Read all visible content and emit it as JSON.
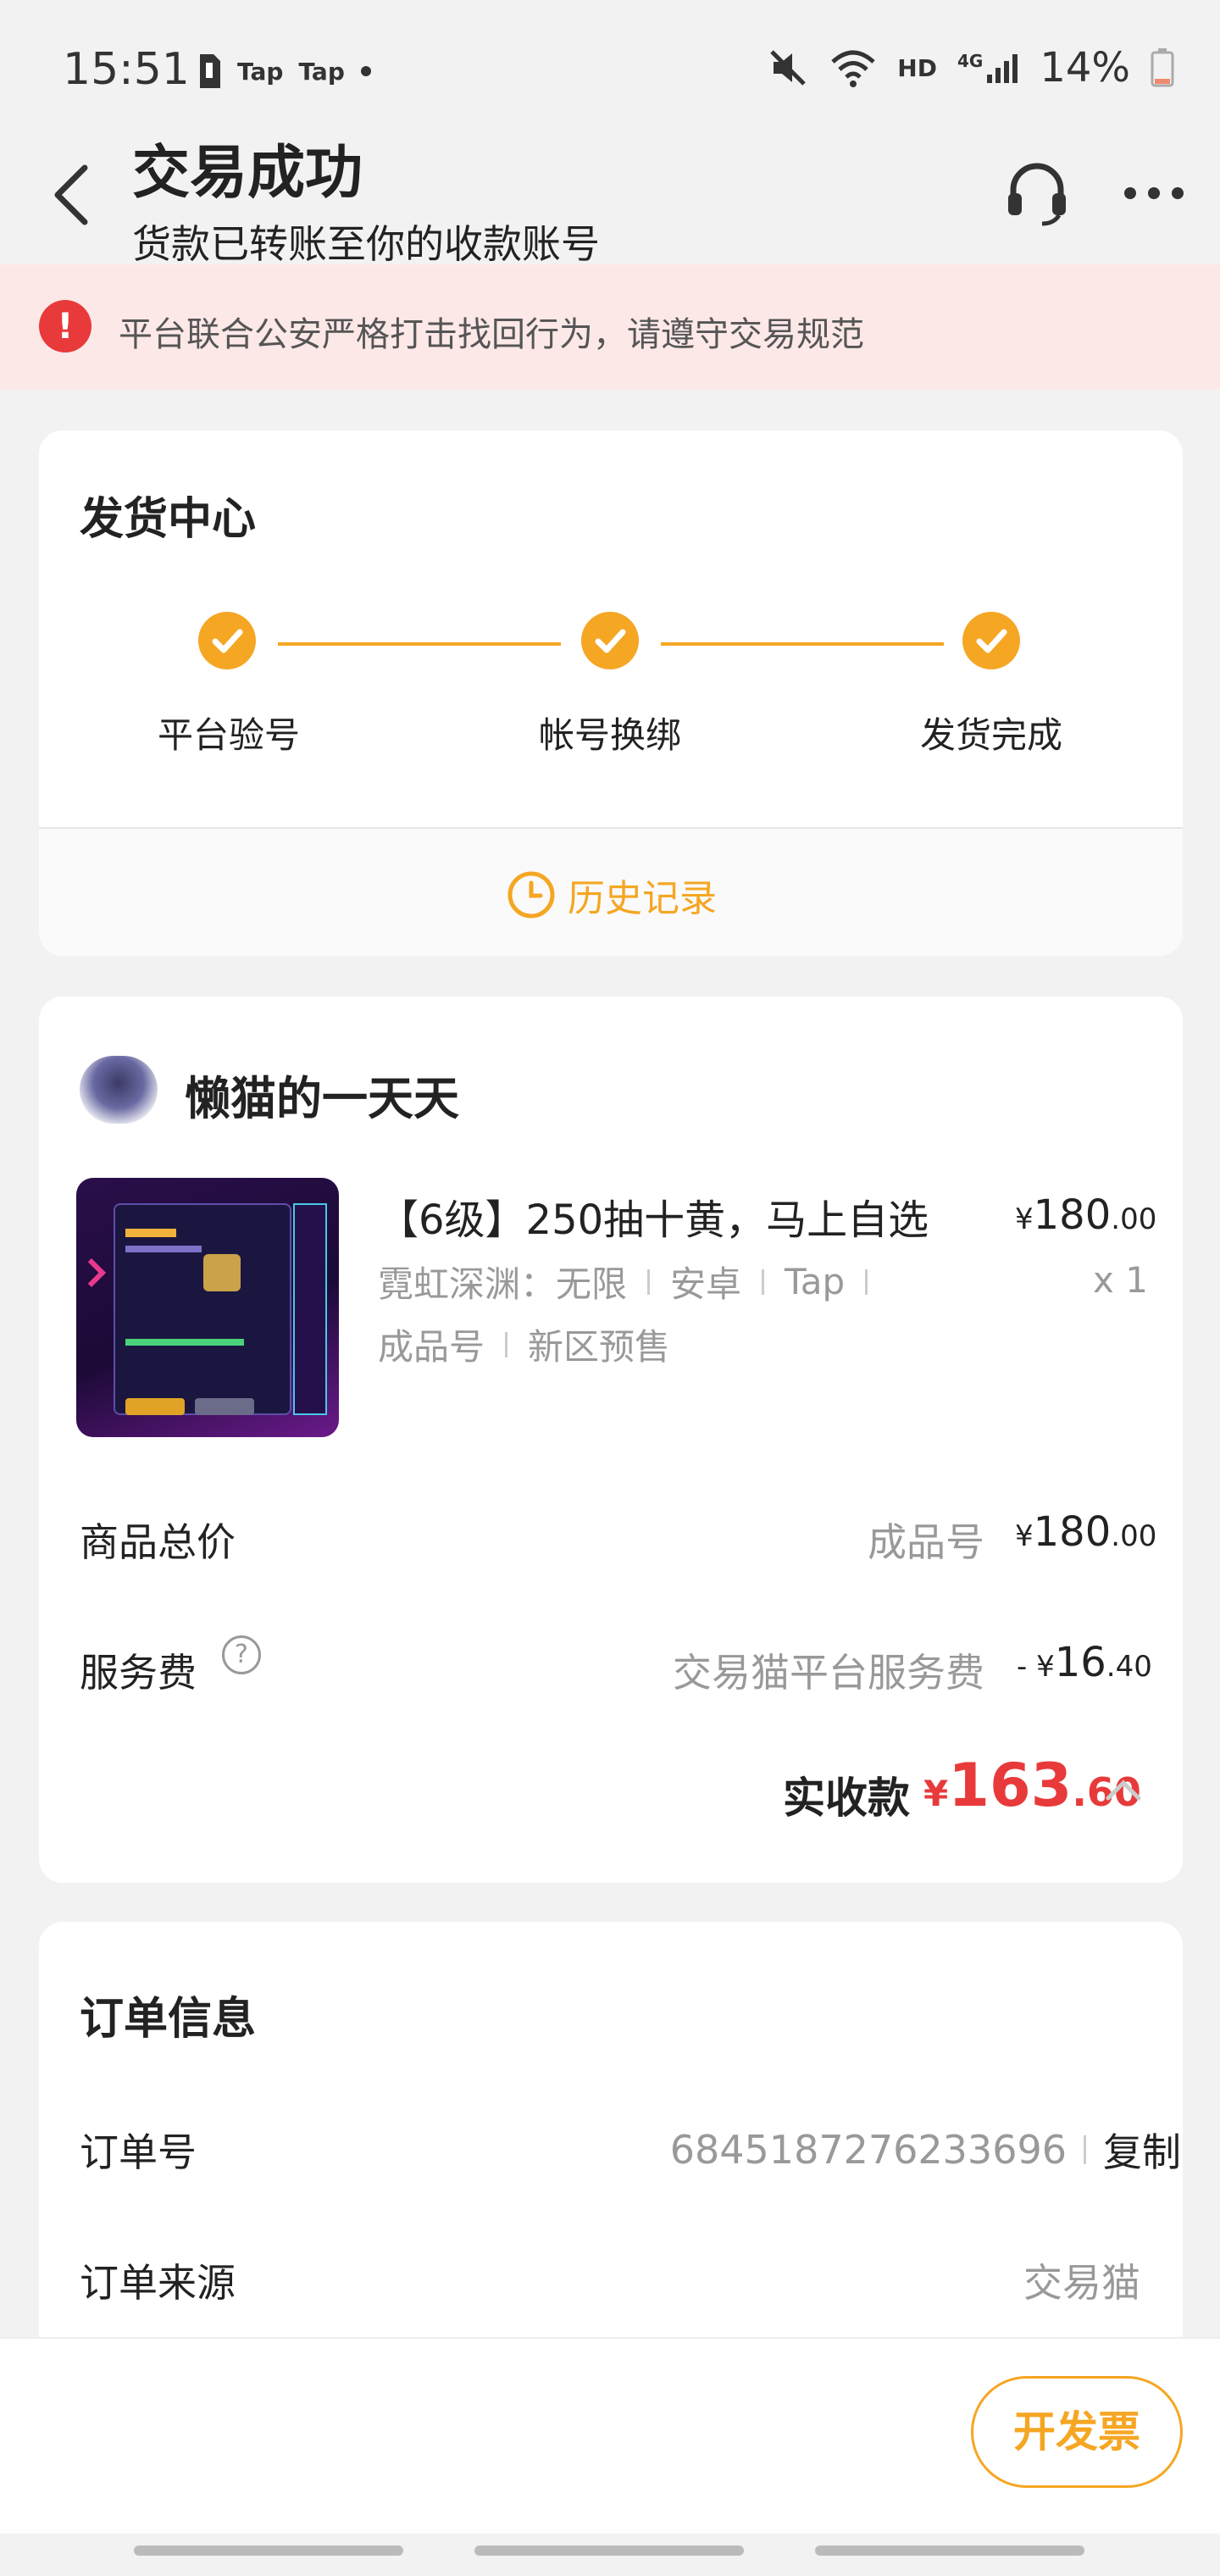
{
  "status_bar": {
    "time": "15:51",
    "app_icons": [
      "Tap",
      "Tap"
    ],
    "battery_percent": "14%",
    "hd_label": "HD",
    "network_label": "4G"
  },
  "header": {
    "title": "交易成功",
    "subtitle": "货款已转账至你的收款账号"
  },
  "warning": {
    "text": "平台联合公安严格打击找回行为，请遵守交易规范"
  },
  "delivery": {
    "title": "发货中心",
    "steps": [
      {
        "label": "平台验号"
      },
      {
        "label": "帐号换绑"
      },
      {
        "label": "发货完成"
      }
    ],
    "history_label": "历史记录"
  },
  "product": {
    "seller_name": "懒猫的一天天",
    "item_title": "【6级】250抽十黄，马上自选",
    "item_price_symbol": "¥",
    "item_price_int": "180",
    "item_price_dec": ".00",
    "item_qty": "x 1",
    "tags_line1": [
      "霓虹深渊：无限",
      "安卓",
      "Tap"
    ],
    "tags_line2": [
      "成品号",
      "新区预售"
    ],
    "total_label": "商品总价",
    "total_desc": "成品号",
    "total_symbol": "¥",
    "total_int": "180",
    "total_dec": ".00",
    "fee_label": "服务费",
    "fee_desc": "交易猫平台服务费",
    "fee_prefix": "- ¥",
    "fee_int": "16",
    "fee_dec": ".40",
    "received_label": "实收款",
    "received_symbol": "¥",
    "received_int": "163",
    "received_dec": ".60"
  },
  "order": {
    "title": "订单信息",
    "number_label": "订单号",
    "number_value": "6845187276233696",
    "copy_label": "复制",
    "source_label": "订单来源",
    "source_value": "交易猫"
  },
  "bottom": {
    "invoice_label": "开发票"
  },
  "colors": {
    "accent": "#f5a623",
    "danger": "#e83a3a",
    "warning_bg": "#fde8e8"
  }
}
